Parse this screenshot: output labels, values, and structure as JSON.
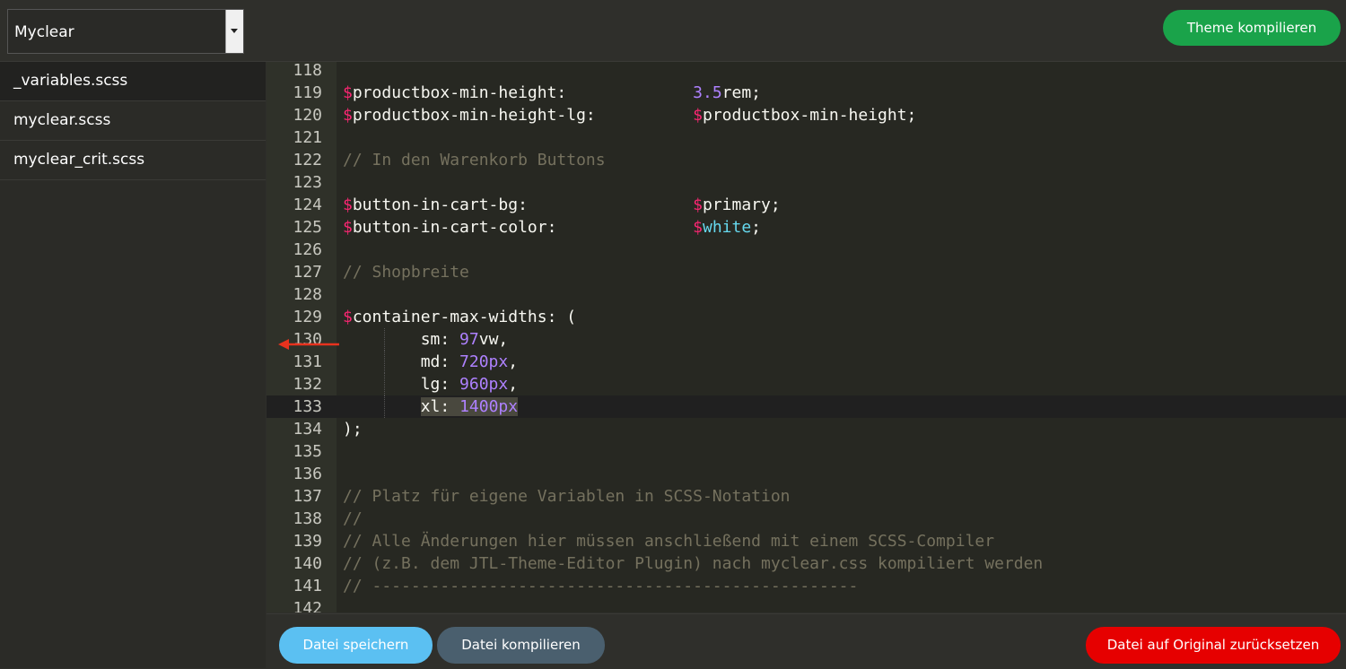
{
  "header": {
    "theme_select": {
      "value": "Myclear",
      "arrow_icon": "caret-down-icon"
    },
    "compile_theme_label": "Theme kompilieren"
  },
  "sidebar": {
    "files": [
      {
        "label": "_variables.scss",
        "active": true
      },
      {
        "label": "myclear.scss",
        "active": false
      },
      {
        "label": "myclear_crit.scss",
        "active": false
      }
    ]
  },
  "editor": {
    "active_line": "133",
    "lines": [
      {
        "n": "118",
        "segments": []
      },
      {
        "n": "119",
        "segments": [
          {
            "t": "$",
            "c": "dollar"
          },
          {
            "t": "productbox-min-height:             ",
            "c": "plain"
          },
          {
            "t": "3.5",
            "c": "num"
          },
          {
            "t": "rem;",
            "c": "plain"
          }
        ]
      },
      {
        "n": "120",
        "segments": [
          {
            "t": "$",
            "c": "dollar"
          },
          {
            "t": "productbox-min-height-lg:          ",
            "c": "plain"
          },
          {
            "t": "$",
            "c": "dollar"
          },
          {
            "t": "productbox-min-height;",
            "c": "plain"
          }
        ]
      },
      {
        "n": "121",
        "segments": []
      },
      {
        "n": "122",
        "segments": [
          {
            "t": "// In den Warenkorb Buttons",
            "c": "comment"
          }
        ]
      },
      {
        "n": "123",
        "segments": []
      },
      {
        "n": "124",
        "segments": [
          {
            "t": "$",
            "c": "dollar"
          },
          {
            "t": "button-in-cart-bg:                 ",
            "c": "plain"
          },
          {
            "t": "$",
            "c": "dollar"
          },
          {
            "t": "primary;",
            "c": "plain"
          }
        ]
      },
      {
        "n": "125",
        "segments": [
          {
            "t": "$",
            "c": "dollar"
          },
          {
            "t": "button-in-cart-color:              ",
            "c": "plain"
          },
          {
            "t": "$",
            "c": "dollar"
          },
          {
            "t": "white",
            "c": "const"
          },
          {
            "t": ";",
            "c": "plain"
          }
        ]
      },
      {
        "n": "126",
        "segments": []
      },
      {
        "n": "127",
        "segments": [
          {
            "t": "// Shopbreite",
            "c": "comment"
          }
        ]
      },
      {
        "n": "128",
        "segments": []
      },
      {
        "n": "129",
        "segments": [
          {
            "t": "$",
            "c": "dollar"
          },
          {
            "t": "container-max-widths: (",
            "c": "plain"
          }
        ]
      },
      {
        "n": "130",
        "indent": true,
        "segments": [
          {
            "t": "        sm: ",
            "c": "plain"
          },
          {
            "t": "97",
            "c": "num"
          },
          {
            "t": "vw,",
            "c": "plain"
          }
        ]
      },
      {
        "n": "131",
        "indent": true,
        "segments": [
          {
            "t": "        md: ",
            "c": "plain"
          },
          {
            "t": "720px",
            "c": "num"
          },
          {
            "t": ",",
            "c": "plain"
          }
        ]
      },
      {
        "n": "132",
        "indent": true,
        "segments": [
          {
            "t": "        lg: ",
            "c": "plain"
          },
          {
            "t": "960px",
            "c": "num"
          },
          {
            "t": ",",
            "c": "plain"
          }
        ]
      },
      {
        "n": "133",
        "indent": true,
        "segments": [
          {
            "t": "        ",
            "c": "plain"
          },
          {
            "t": "xl: ",
            "c": "plain",
            "sel": true
          },
          {
            "t": "1400px",
            "c": "num",
            "sel": true
          }
        ]
      },
      {
        "n": "134",
        "segments": [
          {
            "t": ");",
            "c": "plain"
          }
        ]
      },
      {
        "n": "135",
        "segments": []
      },
      {
        "n": "136",
        "segments": []
      },
      {
        "n": "137",
        "segments": [
          {
            "t": "// Platz für eigene Variablen in SCSS-Notation",
            "c": "comment"
          }
        ]
      },
      {
        "n": "138",
        "segments": [
          {
            "t": "//",
            "c": "comment"
          }
        ]
      },
      {
        "n": "139",
        "segments": [
          {
            "t": "// Alle Änderungen hier müssen anschließend mit einem SCSS-Compiler",
            "c": "comment"
          }
        ]
      },
      {
        "n": "140",
        "segments": [
          {
            "t": "// (z.B. dem JTL-Theme-Editor Plugin) nach myclear.css kompiliert werden",
            "c": "comment"
          }
        ]
      },
      {
        "n": "141",
        "segments": [
          {
            "t": "// --------------------------------------------------",
            "c": "comment"
          }
        ]
      },
      {
        "n": "142",
        "segments": []
      }
    ],
    "annotation_arrow_color": "#e8321e"
  },
  "footer": {
    "save_label": "Datei speichern",
    "compile_label": "Datei kompilieren",
    "reset_label": "Datei auf Original zurücksetzen"
  },
  "colors": {
    "compile_theme": "#1aa34a",
    "save": "#5bc0f2",
    "compile_file": "#4a5f6e",
    "reset": "#e60000"
  }
}
